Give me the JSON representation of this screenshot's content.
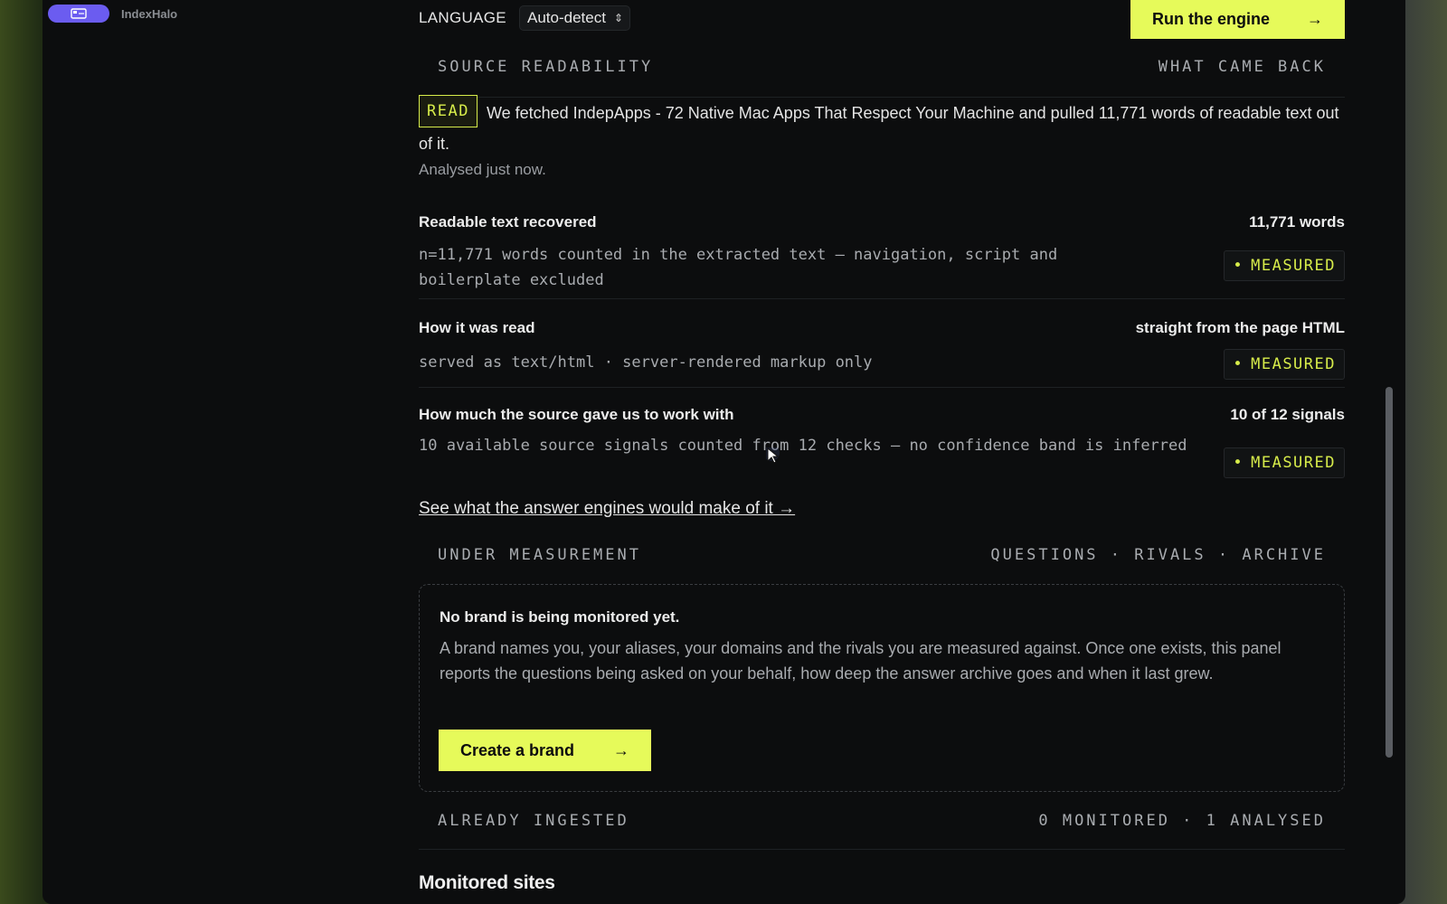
{
  "app": {
    "name": "IndexHalo"
  },
  "topbar": {
    "language_label": "LANGUAGE",
    "language_value": "Auto-detect",
    "run_label": "Run the engine",
    "run_arrow": "→"
  },
  "readability": {
    "left_heading": "SOURCE READABILITY",
    "right_heading": "WHAT CAME BACK",
    "badge": "READ",
    "summary": "We fetched IndepApps - 72 Native Mac Apps That Respect Your Machine and pulled 11,771 words of readable text out of it.",
    "analysed": "Analysed just now."
  },
  "metrics": [
    {
      "title": "Readable text recovered",
      "value": "11,771 words",
      "desc": "n=11,771 words counted in the extracted text — navigation, script and boilerplate excluded",
      "badge": "MEASURED"
    },
    {
      "title": "How it was read",
      "value": "straight from the page HTML",
      "desc": "served as text/html · server-rendered markup only",
      "badge": "MEASURED"
    },
    {
      "title": "How much the source gave us to work with",
      "value": "10 of 12 signals",
      "desc": "10 available source signals counted from 12 checks — no confidence band is inferred",
      "badge": "MEASURED"
    }
  ],
  "see_link": "See what the answer engines would make of it →",
  "measurement": {
    "left_heading": "UNDER MEASUREMENT",
    "right_heading": "QUESTIONS · RIVALS · ARCHIVE",
    "panel_title": "No brand is being monitored yet.",
    "panel_text": "A brand names you, your aliases, your domains and the rivals you are measured against. Once one exists, this panel reports the questions being asked on your behalf, how deep the answer archive goes and when it last grew.",
    "create_label": "Create a brand",
    "create_arrow": "→"
  },
  "ingested": {
    "left_heading": "ALREADY INGESTED",
    "right_heading": "0 MONITORED · 1 ANALYSED",
    "sites_title": "Monitored sites"
  },
  "colors": {
    "accent": "#e6fa5a",
    "brand_pill": "#6b5cf0",
    "background": "#0c0d0e"
  }
}
